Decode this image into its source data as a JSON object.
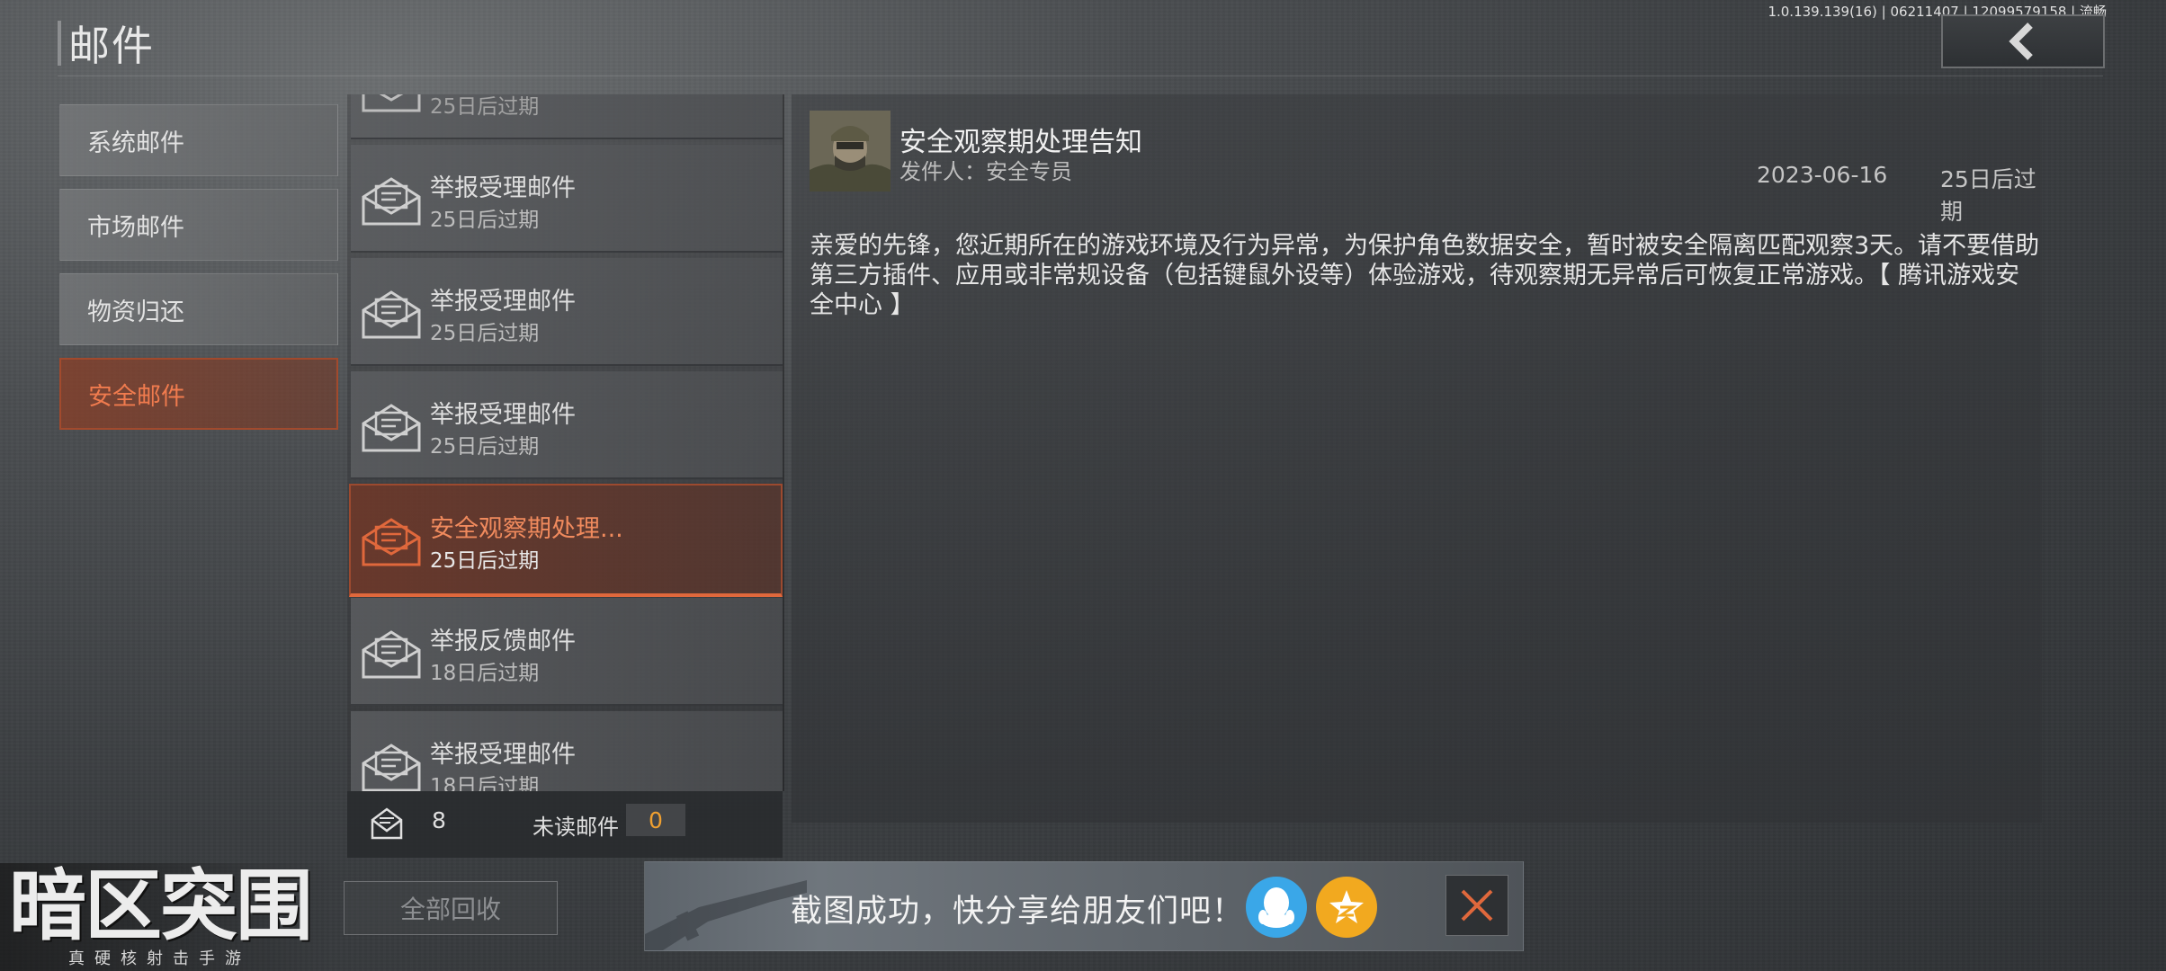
{
  "header": {
    "title": "邮件",
    "version": "1.0.139.139(16) | 06211407 | 12099579158 | 流畅"
  },
  "categories": [
    {
      "label": "系统邮件",
      "active": false
    },
    {
      "label": "市场邮件",
      "active": false
    },
    {
      "label": "物资归还",
      "active": false
    },
    {
      "label": "安全邮件",
      "active": true
    }
  ],
  "mail_list": [
    {
      "title": "",
      "expiry": "25日后过期",
      "state": "partial"
    },
    {
      "title": "举报受理邮件",
      "expiry": "25日后过期",
      "state": "read"
    },
    {
      "title": "举报受理邮件",
      "expiry": "25日后过期",
      "state": "read"
    },
    {
      "title": "举报受理邮件",
      "expiry": "25日后过期",
      "state": "read"
    },
    {
      "title": "安全观察期处理...",
      "expiry": "25日后过期",
      "state": "selected"
    },
    {
      "title": "举报反馈邮件",
      "expiry": "18日后过期",
      "state": "read"
    },
    {
      "title": "举报受理邮件",
      "expiry": "18日后过期",
      "state": "read"
    }
  ],
  "list_footer": {
    "total_count": "8",
    "unread_label": "未读邮件",
    "unread_count": "0"
  },
  "recycle_all_label": "全部回收",
  "detail": {
    "subject": "安全观察期处理告知",
    "sender": "发件人：安全专员",
    "date": "2023-06-16",
    "expiry": "25日后过期",
    "body": "亲爱的先锋，您近期所在的游戏环境及行为异常，为保护角色数据安全，暂时被安全隔离匹配观察3天。请不要借助第三方插件、应用或非常规设备（包括键鼠外设等）体验游戏，待观察期无异常后可恢复正常游戏。【 腾讯游戏安全中心 】"
  },
  "share_toast": {
    "text": "截图成功，快分享给朋友们吧！",
    "buttons": [
      "qq-icon",
      "qzone-icon",
      "close-icon"
    ]
  },
  "logo": {
    "main": "暗区突围",
    "sub": "真硬核射击手游"
  },
  "colors": {
    "accent": "#e0683c",
    "accent_text": "#f07b4e",
    "unread_count": "#f0a030",
    "qq": "#3aa7e8",
    "qzone": "#f2a91f"
  }
}
